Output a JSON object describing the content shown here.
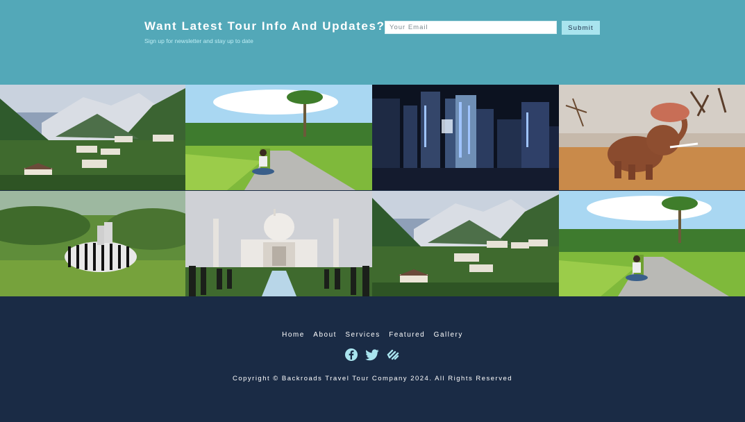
{
  "newsletter": {
    "title": "Want Latest Tour Info And Updates?",
    "subtitle": "Sign up for newsletter and stay up to date",
    "email_placeholder": "Your Email",
    "submit_label": "Submit"
  },
  "gallery": {
    "images": [
      {
        "subject": "mountain-valley-village"
      },
      {
        "subject": "girl-on-road-palms"
      },
      {
        "subject": "city-night-skyline"
      },
      {
        "subject": "elephant-dust"
      },
      {
        "subject": "zebras-grass"
      },
      {
        "subject": "taj-mahal"
      },
      {
        "subject": "mountain-valley-village"
      },
      {
        "subject": "girl-on-road-palms"
      }
    ]
  },
  "footer": {
    "nav": [
      "Home",
      "About",
      "Services",
      "Featured",
      "Gallery"
    ],
    "social_icons": [
      "facebook-icon",
      "twitter-icon",
      "squarespace-icon"
    ],
    "copyright": "Copyright © Backroads Travel Tour Company 2024. All Rights Reserved"
  },
  "colors": {
    "newsletter_bg": "#53a8b8",
    "footer_bg": "#1a2b45",
    "accent": "#a9e4ee",
    "icon": "#a9e4ee"
  }
}
